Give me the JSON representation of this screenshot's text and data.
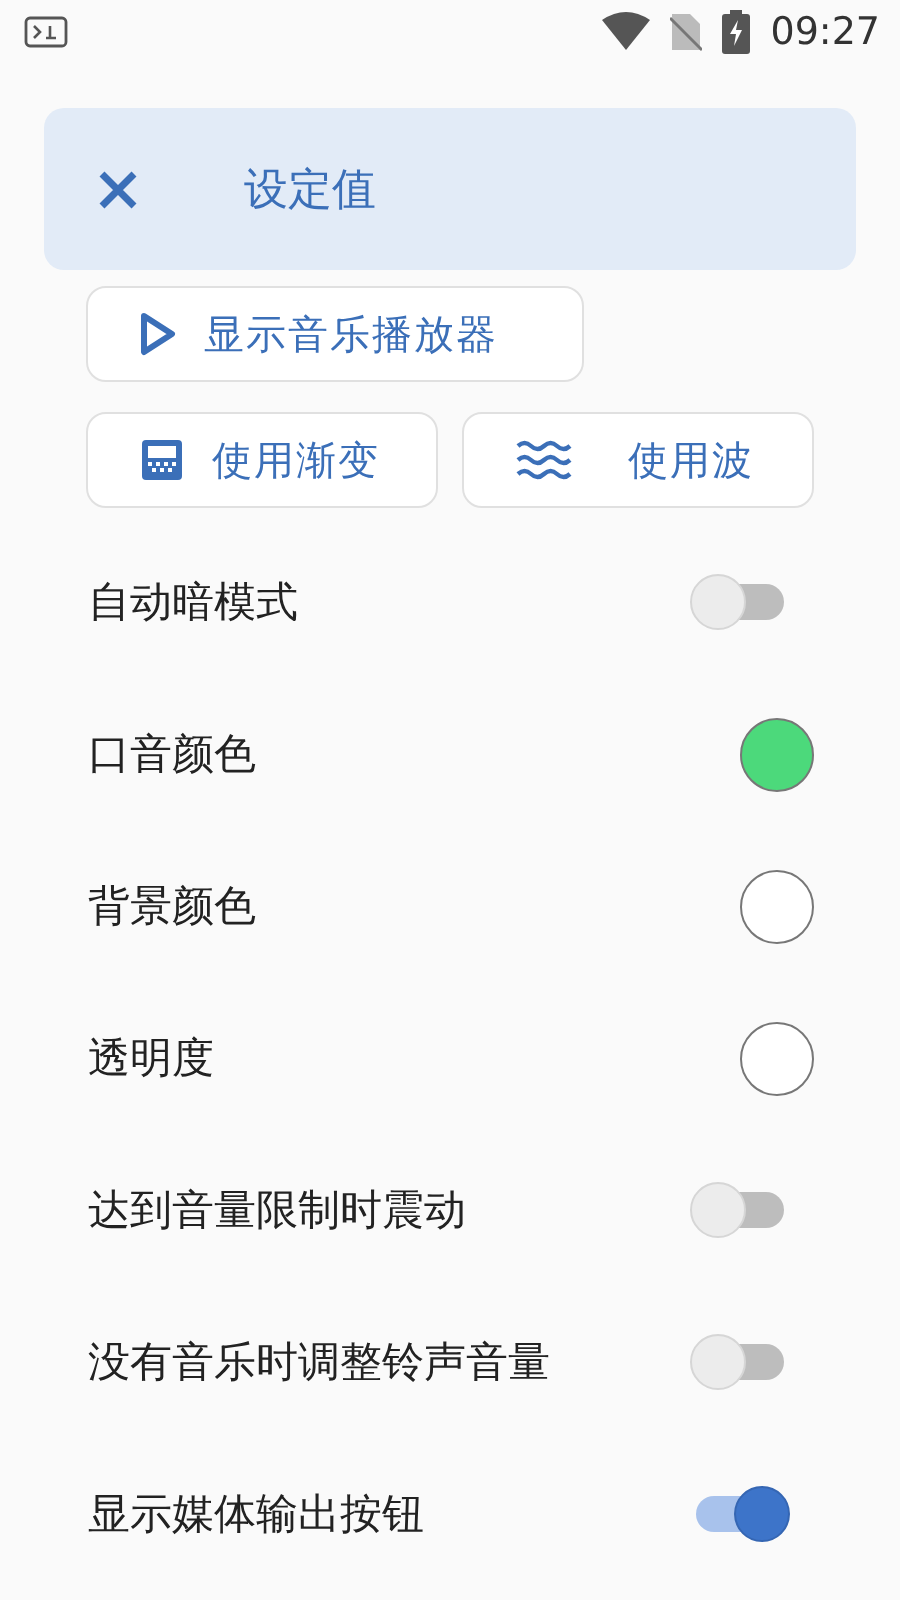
{
  "status_bar": {
    "time": "09:27"
  },
  "header": {
    "title": "设定值"
  },
  "player_button": {
    "label": "显示音乐播放器"
  },
  "option_buttons": [
    {
      "kind": "gradient",
      "label": "使用渐变"
    },
    {
      "kind": "wave",
      "label": "使用波"
    }
  ],
  "settings": [
    {
      "kind": "toggle",
      "label": "自动暗模式",
      "on": false
    },
    {
      "kind": "color",
      "label": "口音颜色",
      "color": "#4cd97b"
    },
    {
      "kind": "color",
      "label": "背景颜色",
      "color": "#ffffff"
    },
    {
      "kind": "color",
      "label": "透明度",
      "color": "#ffffff"
    },
    {
      "kind": "toggle",
      "label": "达到音量限制时震动",
      "on": false
    },
    {
      "kind": "toggle",
      "label": "没有音乐时调整铃声音量",
      "on": false
    },
    {
      "kind": "toggle",
      "label": "显示媒体输出按钮",
      "on": true
    }
  ]
}
